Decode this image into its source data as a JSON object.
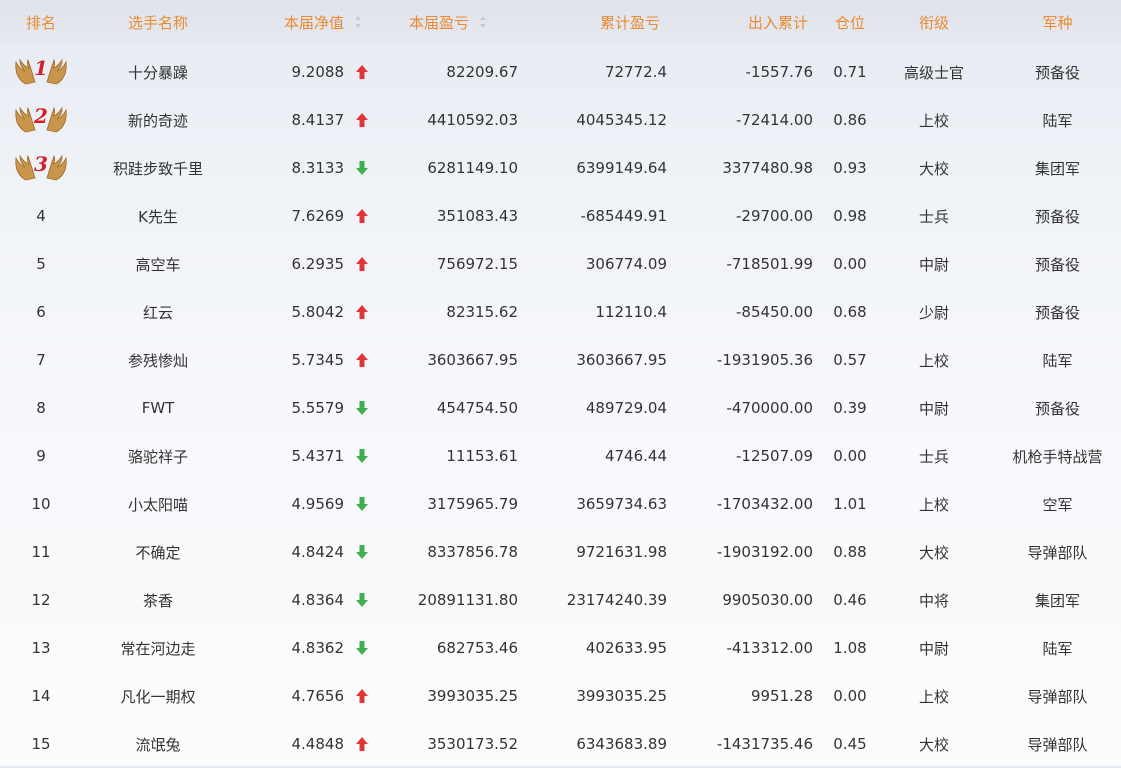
{
  "headers": {
    "rank": "排名",
    "name": "选手名称",
    "nav": "本届净值",
    "profit": "本届盈亏",
    "cum_profit": "累计盈亏",
    "io": "出入累计",
    "position": "仓位",
    "rank_title": "衔级",
    "arm": "军种"
  },
  "colors": {
    "header_text": "#ea8a32",
    "up": "#e0353a",
    "down": "#3db04b",
    "medal_number": "#d3202a"
  },
  "rows": [
    {
      "rank": "1",
      "name": "十分暴躁",
      "nav": "9.2088",
      "trend": "up",
      "profit": "82209.67",
      "cum_profit": "72772.4",
      "io": "-1557.76",
      "position": "0.71",
      "rank_title": "高级士官",
      "arm": "预备役"
    },
    {
      "rank": "2",
      "name": "新的奇迹",
      "nav": "8.4137",
      "trend": "up",
      "profit": "4410592.03",
      "cum_profit": "4045345.12",
      "io": "-72414.00",
      "position": "0.86",
      "rank_title": "上校",
      "arm": "陆军"
    },
    {
      "rank": "3",
      "name": "积跬步致千里",
      "nav": "8.3133",
      "trend": "down",
      "profit": "6281149.10",
      "cum_profit": "6399149.64",
      "io": "3377480.98",
      "position": "0.93",
      "rank_title": "大校",
      "arm": "集团军"
    },
    {
      "rank": "4",
      "name": "K先生",
      "nav": "7.6269",
      "trend": "up",
      "profit": "351083.43",
      "cum_profit": "-685449.91",
      "io": "-29700.00",
      "position": "0.98",
      "rank_title": "士兵",
      "arm": "预备役"
    },
    {
      "rank": "5",
      "name": "高空车",
      "nav": "6.2935",
      "trend": "up",
      "profit": "756972.15",
      "cum_profit": "306774.09",
      "io": "-718501.99",
      "position": "0.00",
      "rank_title": "中尉",
      "arm": "预备役"
    },
    {
      "rank": "6",
      "name": "红云",
      "nav": "5.8042",
      "trend": "up",
      "profit": "82315.62",
      "cum_profit": "112110.4",
      "io": "-85450.00",
      "position": "0.68",
      "rank_title": "少尉",
      "arm": "预备役"
    },
    {
      "rank": "7",
      "name": "参残惨灿",
      "nav": "5.7345",
      "trend": "up",
      "profit": "3603667.95",
      "cum_profit": "3603667.95",
      "io": "-1931905.36",
      "position": "0.57",
      "rank_title": "上校",
      "arm": "陆军"
    },
    {
      "rank": "8",
      "name": "FWT",
      "nav": "5.5579",
      "trend": "down",
      "profit": "454754.50",
      "cum_profit": "489729.04",
      "io": "-470000.00",
      "position": "0.39",
      "rank_title": "中尉",
      "arm": "预备役"
    },
    {
      "rank": "9",
      "name": "骆驼祥子",
      "nav": "5.4371",
      "trend": "down",
      "profit": "11153.61",
      "cum_profit": "4746.44",
      "io": "-12507.09",
      "position": "0.00",
      "rank_title": "士兵",
      "arm": "机枪手特战营"
    },
    {
      "rank": "10",
      "name": "小太阳喵",
      "nav": "4.9569",
      "trend": "down",
      "profit": "3175965.79",
      "cum_profit": "3659734.63",
      "io": "-1703432.00",
      "position": "1.01",
      "rank_title": "上校",
      "arm": "空军"
    },
    {
      "rank": "11",
      "name": "不确定",
      "nav": "4.8424",
      "trend": "down",
      "profit": "8337856.78",
      "cum_profit": "9721631.98",
      "io": "-1903192.00",
      "position": "0.88",
      "rank_title": "大校",
      "arm": "导弹部队"
    },
    {
      "rank": "12",
      "name": "茶香",
      "nav": "4.8364",
      "trend": "down",
      "profit": "20891131.80",
      "cum_profit": "23174240.39",
      "io": "9905030.00",
      "position": "0.46",
      "rank_title": "中将",
      "arm": "集团军"
    },
    {
      "rank": "13",
      "name": "常在河边走",
      "nav": "4.8362",
      "trend": "down",
      "profit": "682753.46",
      "cum_profit": "402633.95",
      "io": "-413312.00",
      "position": "1.08",
      "rank_title": "中尉",
      "arm": "陆军"
    },
    {
      "rank": "14",
      "name": "凡化一期权",
      "nav": "4.7656",
      "trend": "up",
      "profit": "3993035.25",
      "cum_profit": "3993035.25",
      "io": "9951.28",
      "position": "0.00",
      "rank_title": "上校",
      "arm": "导弹部队"
    },
    {
      "rank": "15",
      "name": "流氓兔",
      "nav": "4.4848",
      "trend": "up",
      "profit": "3530173.52",
      "cum_profit": "6343683.89",
      "io": "-1431735.46",
      "position": "0.45",
      "rank_title": "大校",
      "arm": "导弹部队"
    }
  ]
}
